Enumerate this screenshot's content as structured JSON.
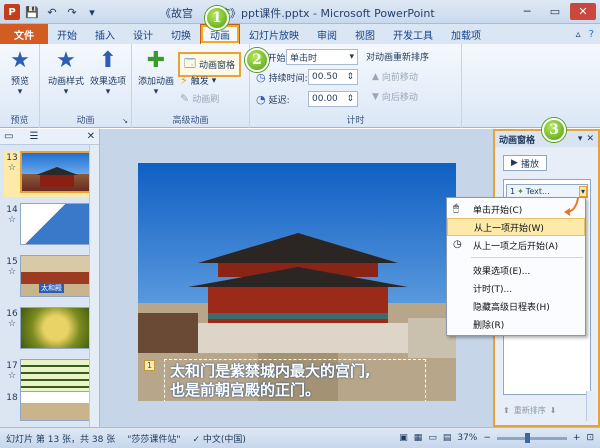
{
  "window": {
    "title_before": "《故宫",
    "title_after": "院》ppt课件.pptx - Microsoft PowerPoint",
    "logo": "P"
  },
  "qat": {
    "save_icon": "💾",
    "undo_icon": "↶",
    "redo_icon": "↷",
    "customize_icon": "▾"
  },
  "window_buttons": {
    "minimize": "─",
    "maximize": "▭",
    "close": "✕"
  },
  "tabs": [
    {
      "label": "文件"
    },
    {
      "label": "开始"
    },
    {
      "label": "插入"
    },
    {
      "label": "设计"
    },
    {
      "label": "切换"
    },
    {
      "label": "动画"
    },
    {
      "label": "幻灯片放映"
    },
    {
      "label": "审阅"
    },
    {
      "label": "视图"
    },
    {
      "label": "开发工具"
    },
    {
      "label": "加载项"
    }
  ],
  "ribbon": {
    "preview": {
      "label": "预览",
      "group": "预览"
    },
    "animation": {
      "style_label": "动画样式",
      "effect_label": "效果选项",
      "group": "动画"
    },
    "advanced": {
      "add_label": "添加动画",
      "pane_label": "动画窗格",
      "trigger_label": "触发",
      "painter_label": "动画刷",
      "group": "高级动画"
    },
    "timing": {
      "start_label": "开始:",
      "start_value": "单击时",
      "duration_label": "持续时间:",
      "duration_value": "00.50",
      "delay_label": "延迟:",
      "delay_value": "00.00",
      "reorder_label": "对动画重新排序",
      "move_earlier": "向前移动",
      "move_later": "向后移动",
      "group": "计时"
    }
  },
  "badges": {
    "one": "1",
    "two": "2",
    "three": "3"
  },
  "thumbs": [
    {
      "num": "13",
      "star": "☆"
    },
    {
      "num": "14",
      "star": "☆"
    },
    {
      "num": "15",
      "star": "☆"
    },
    {
      "num": "16",
      "star": "☆"
    },
    {
      "num": "17",
      "star": "☆"
    },
    {
      "num": "18",
      "star": ""
    }
  ],
  "thumb_texts": {
    "t15": "太和殿"
  },
  "slide": {
    "tag": "1",
    "line1": "太和门是紫禁城内最大的宫门,",
    "line2": "也是前朝宫殿的正门。"
  },
  "anim_pane": {
    "title": "动画窗格",
    "play": "播放",
    "item_num": "1",
    "item_text": "Text...",
    "reorder": "重新排序"
  },
  "context_menu": [
    {
      "label": "单击开始(C)",
      "icon": "🖱"
    },
    {
      "label": "从上一项开始(W)",
      "icon": ""
    },
    {
      "label": "从上一项之后开始(A)",
      "icon": "◷"
    },
    {
      "label": "效果选项(E)...",
      "icon": ""
    },
    {
      "label": "计时(T)...",
      "icon": ""
    },
    {
      "label": "隐藏高级日程表(H)",
      "icon": ""
    },
    {
      "label": "删除(R)",
      "icon": ""
    }
  ],
  "status": {
    "slide_info": "幻灯片 第 13 张，共 38 张",
    "theme": "\"莎莎课件站\"",
    "lang": "中文(中国)",
    "zoom": "37%"
  },
  "colors": {
    "accent": "#e8a23a",
    "file_tab": "#d35c23",
    "badge": "#4f9b13"
  }
}
